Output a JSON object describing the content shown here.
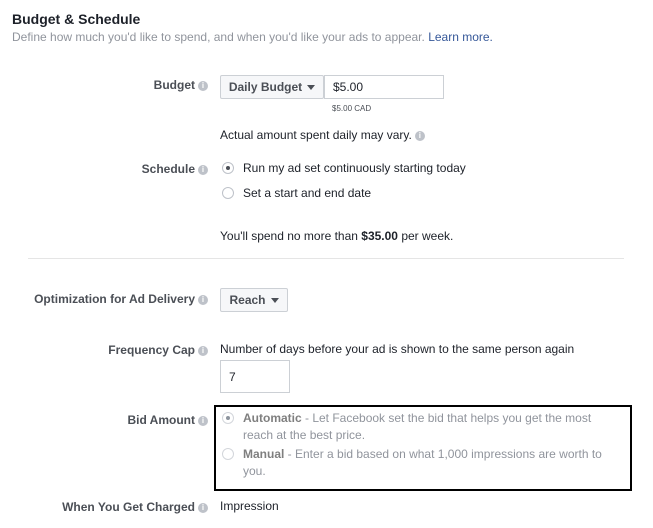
{
  "section": {
    "title": "Budget & Schedule",
    "subtitle": "Define how much you'd like to spend, and when you'd like your ads to appear.",
    "learn_more": "Learn more."
  },
  "budget": {
    "label": "Budget",
    "type_button": "Daily Budget",
    "amount_value": "$5.00",
    "amount_sub": "$5.00 CAD",
    "note": "Actual amount spent daily may vary."
  },
  "schedule": {
    "label": "Schedule",
    "options": [
      {
        "label": "Run my ad set continuously starting today",
        "selected": true
      },
      {
        "label": "Set a start and end date",
        "selected": false
      }
    ],
    "spend_prefix": "You'll spend no more than ",
    "spend_amount": "$35.00",
    "spend_suffix": " per week."
  },
  "optimization": {
    "label": "Optimization for Ad Delivery",
    "value": "Reach"
  },
  "frequency": {
    "label": "Frequency Cap",
    "description": "Number of days before your ad is shown to the same person again",
    "value": "7"
  },
  "bid": {
    "label": "Bid Amount",
    "options": [
      {
        "title": "Automatic",
        "desc": " - Let Facebook set the bid that helps you get the most reach at the best price.",
        "selected": true
      },
      {
        "title": "Manual",
        "desc": " - Enter a bid based on what 1,000 impressions are worth to you.",
        "selected": false
      }
    ]
  },
  "charged": {
    "label": "When You Get Charged",
    "value": "Impression"
  },
  "icons": {
    "info": "info-icon",
    "dropdown": "caret-down-icon"
  }
}
